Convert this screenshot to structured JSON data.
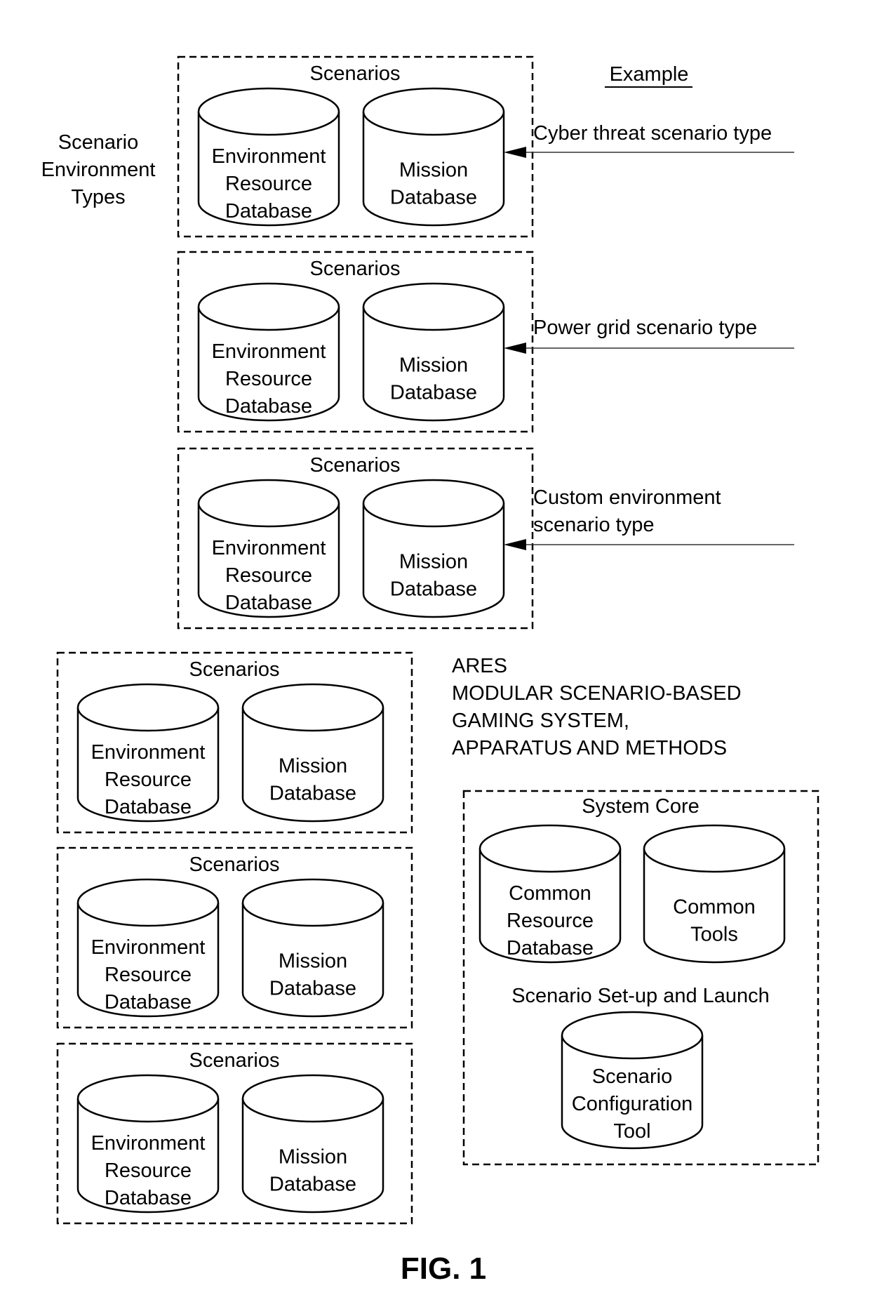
{
  "left_label": [
    "Scenario",
    "Environment",
    "Types"
  ],
  "example_heading": "Example",
  "scenario_groups": [
    {
      "title": "Scenarios",
      "databases": [
        {
          "lines": [
            "Environment",
            "Resource",
            "Database"
          ]
        },
        {
          "lines": [
            "Mission",
            "Database"
          ]
        }
      ],
      "example": [
        "Cyber threat scenario type"
      ]
    },
    {
      "title": "Scenarios",
      "databases": [
        {
          "lines": [
            "Environment",
            "Resource",
            "Database"
          ]
        },
        {
          "lines": [
            "Mission",
            "Database"
          ]
        }
      ],
      "example": [
        "Power grid scenario type"
      ]
    },
    {
      "title": "Scenarios",
      "databases": [
        {
          "lines": [
            "Environment",
            "Resource",
            "Database"
          ]
        },
        {
          "lines": [
            "Mission",
            "Database"
          ]
        }
      ],
      "example": [
        "Custom environment",
        "scenario type"
      ]
    },
    {
      "title": "Scenarios",
      "databases": [
        {
          "lines": [
            "Environment",
            "Resource",
            "Database"
          ]
        },
        {
          "lines": [
            "Mission",
            "Database"
          ]
        }
      ]
    },
    {
      "title": "Scenarios",
      "databases": [
        {
          "lines": [
            "Environment",
            "Resource",
            "Database"
          ]
        },
        {
          "lines": [
            "Mission",
            "Database"
          ]
        }
      ]
    },
    {
      "title": "Scenarios",
      "databases": [
        {
          "lines": [
            "Environment",
            "Resource",
            "Database"
          ]
        },
        {
          "lines": [
            "Mission",
            "Database"
          ]
        }
      ]
    }
  ],
  "system_title": [
    "ARES",
    "MODULAR SCENARIO-BASED",
    "GAMING SYSTEM,",
    "APPARATUS AND METHODS"
  ],
  "system_core": {
    "title": "System Core",
    "databases": [
      {
        "lines": [
          "Common",
          "Resource",
          "Database"
        ]
      },
      {
        "lines": [
          "Common",
          "Tools"
        ]
      }
    ],
    "setup_label": "Scenario Set-up and Launch",
    "config_tool": {
      "lines": [
        "Scenario",
        "Configuration",
        "Tool"
      ]
    }
  },
  "figure_label": "FIG. 1"
}
